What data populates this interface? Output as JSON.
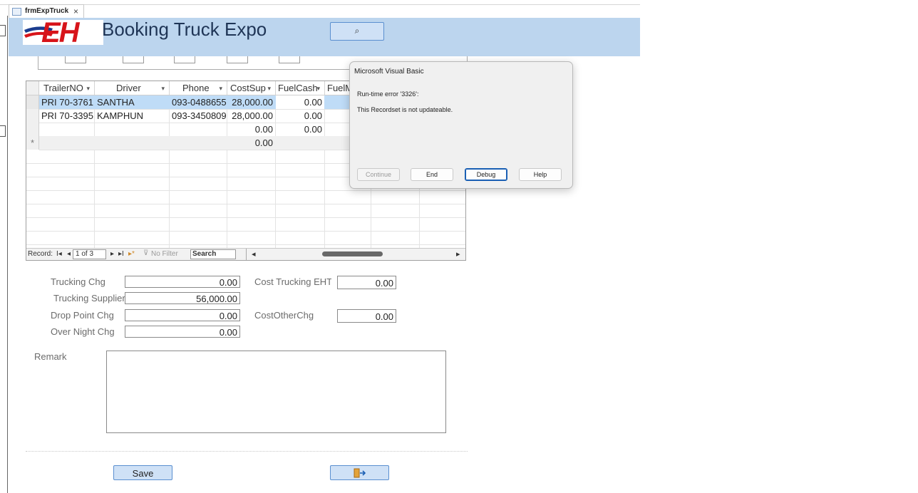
{
  "tab": {
    "title": "frmExpTruck",
    "close": "×"
  },
  "header": {
    "title": "Booking Truck Expo",
    "logo_text": "EH",
    "search_icon": "⌕"
  },
  "grid": {
    "columns": [
      "TrailerNO",
      "Driver",
      "Phone",
      "CostSup",
      "FuelCash",
      "FuelM"
    ],
    "rows": [
      {
        "TrailerNO": "PRI 70-3761",
        "Driver": "SANTHA",
        "Phone": "093-0488655",
        "CostSup": "28,000.00",
        "FuelCash": "0.00"
      },
      {
        "TrailerNO": "PRI 70-3395",
        "Driver": "KAMPHUN",
        "Phone": "093-3450809",
        "CostSup": "28,000.00",
        "FuelCash": "0.00"
      },
      {
        "TrailerNO": "",
        "Driver": "",
        "Phone": "",
        "CostSup": "0.00",
        "FuelCash": "0.00"
      },
      {
        "TrailerNO": "",
        "Driver": "",
        "Phone": "",
        "CostSup": "0.00",
        "FuelCash": ""
      }
    ],
    "new_row_marker": "*",
    "nav": {
      "record_label": "Record:",
      "first": "I◂",
      "prev": "◂",
      "position": "1 of 3",
      "next": "▸",
      "last": "▸I",
      "new": "▸*",
      "filter_label": "No Filter",
      "search_label": "Search"
    }
  },
  "form": {
    "trucking_chg_label": "Trucking Chg",
    "trucking_chg_value": "0.00",
    "trucking_supplier_label": "Trucking Supplier",
    "trucking_supplier_value": "56,000.00",
    "drop_point_chg_label": "Drop Point Chg",
    "drop_point_chg_value": "0.00",
    "over_night_chg_label": "Over Night Chg",
    "over_night_chg_value": "0.00",
    "cost_trucking_label": "Cost Trucking EHT",
    "cost_trucking_value": "0.00",
    "cost_other_chg_label": "CostOtherChg",
    "cost_other_chg_value": "0.00",
    "remark_label": "Remark",
    "remark_value": ""
  },
  "buttons": {
    "save": "Save",
    "exit_icon": "exit-door-icon"
  },
  "dialog": {
    "title": "Microsoft Visual Basic",
    "error_line": "Run-time error '3326':",
    "message": "This Recordset is not updateable.",
    "continue": "Continue",
    "end": "End",
    "debug": "Debug",
    "help": "Help"
  }
}
